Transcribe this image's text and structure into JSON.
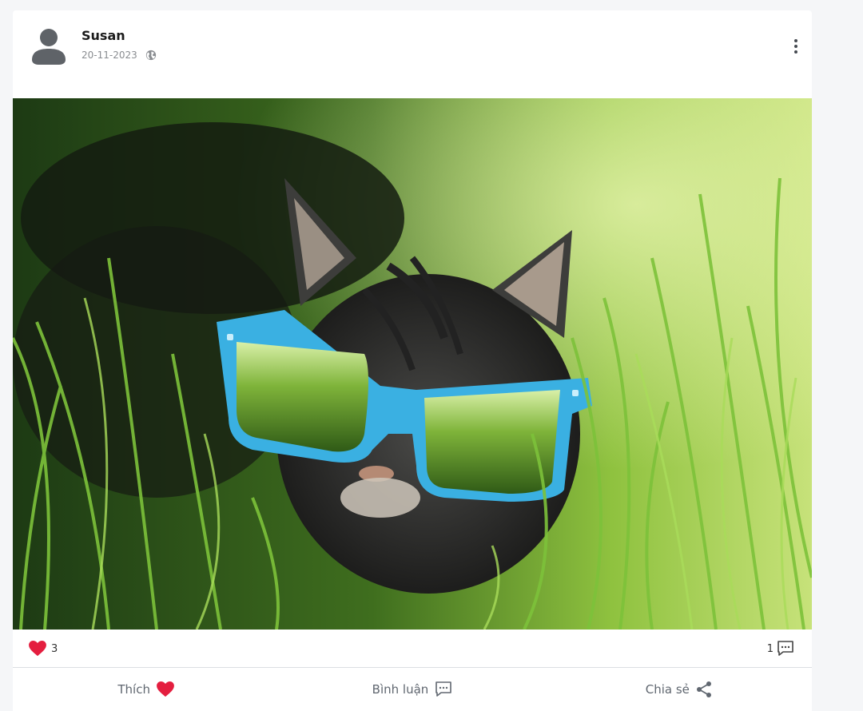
{
  "post": {
    "author": "Susan",
    "date": "20-11-2023",
    "privacy_icon": "globe-icon",
    "image_alt": "Cat wearing blue sunglasses in the grass"
  },
  "stats": {
    "like_count": "3",
    "comment_count": "1"
  },
  "actions": {
    "like_label": "Thích",
    "comment_label": "Bình luận",
    "share_label": "Chia sẻ"
  },
  "colors": {
    "heart": "#e41e3f",
    "glasses": "#3ab0e2",
    "text_muted": "#606770"
  }
}
